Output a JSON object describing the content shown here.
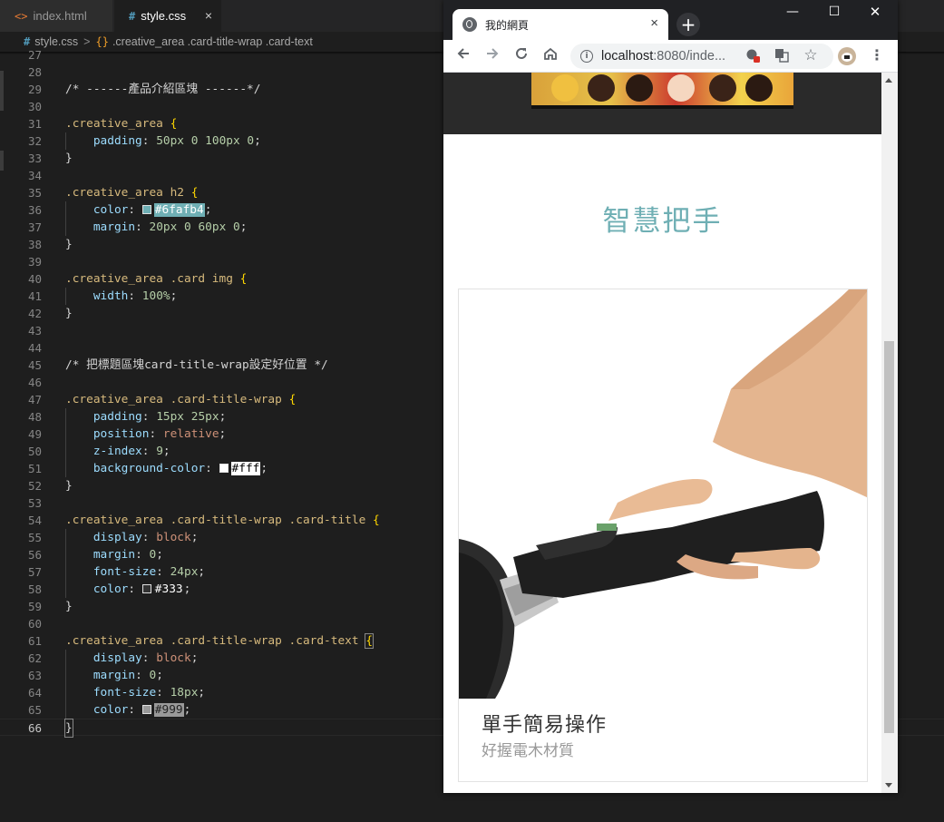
{
  "editor": {
    "tabs": [
      {
        "icon": "<>",
        "label": "index.html"
      },
      {
        "icon": "#",
        "label": "style.css",
        "close": "×"
      }
    ],
    "breadcrumb": {
      "file_icon": "#",
      "file": "style.css",
      "separator": ">",
      "symbol_icon": "{}",
      "symbol": ".creative_area .card-title-wrap .card-text"
    },
    "lines": [
      {
        "n": "27",
        "text": ""
      },
      {
        "n": "28",
        "text": ""
      },
      {
        "n": "29",
        "text": "/* ------產品介紹區塊 ------*/"
      },
      {
        "n": "30",
        "text": ""
      },
      {
        "n": "31",
        "text": ".creative_area {"
      },
      {
        "n": "32",
        "text": "    padding: 50px 0 100px 0;"
      },
      {
        "n": "33",
        "text": "}"
      },
      {
        "n": "34",
        "text": ""
      },
      {
        "n": "35",
        "text": ".creative_area h2 {"
      },
      {
        "n": "36",
        "text": "    color: #6fafb4;"
      },
      {
        "n": "37",
        "text": "    margin: 20px 0 60px 0;"
      },
      {
        "n": "38",
        "text": "}"
      },
      {
        "n": "39",
        "text": ""
      },
      {
        "n": "40",
        "text": ".creative_area .card img {"
      },
      {
        "n": "41",
        "text": "    width: 100%;"
      },
      {
        "n": "42",
        "text": "}"
      },
      {
        "n": "43",
        "text": ""
      },
      {
        "n": "44",
        "text": ""
      },
      {
        "n": "45",
        "text": "/* 把標題區塊card-title-wrap設定好位置 */"
      },
      {
        "n": "46",
        "text": ""
      },
      {
        "n": "47",
        "text": ".creative_area .card-title-wrap {"
      },
      {
        "n": "48",
        "text": "    padding: 15px 25px;"
      },
      {
        "n": "49",
        "text": "    position: relative;"
      },
      {
        "n": "50",
        "text": "    z-index: 9;"
      },
      {
        "n": "51",
        "text": "    background-color: #fff;"
      },
      {
        "n": "52",
        "text": "}"
      },
      {
        "n": "53",
        "text": ""
      },
      {
        "n": "54",
        "text": ".creative_area .card-title-wrap .card-title {"
      },
      {
        "n": "55",
        "text": "    display: block;"
      },
      {
        "n": "56",
        "text": "    margin: 0;"
      },
      {
        "n": "57",
        "text": "    font-size: 24px;"
      },
      {
        "n": "58",
        "text": "    color: #333;"
      },
      {
        "n": "59",
        "text": "}"
      },
      {
        "n": "60",
        "text": ""
      },
      {
        "n": "61",
        "text": ".creative_area .card-title-wrap .card-text {"
      },
      {
        "n": "62",
        "text": "    display: block;"
      },
      {
        "n": "63",
        "text": "    margin: 0;"
      },
      {
        "n": "64",
        "text": "    font-size: 18px;"
      },
      {
        "n": "65",
        "text": "    color: #999;"
      },
      {
        "n": "66",
        "text": "}"
      }
    ],
    "active_line": "66",
    "colors": {
      "background": "#1e1e1e",
      "comment": "#6a9955",
      "selector": "#d7ba7d",
      "property": "#9cdcfe",
      "number": "#b5cea8",
      "keyword": "#ce9178"
    }
  },
  "browser": {
    "tab_title": "我的網頁",
    "tab_close": "×",
    "new_tab": "+",
    "window_controls": {
      "minimize": "—",
      "maximize": "☐",
      "close": "✕"
    },
    "url_host": "localhost",
    "url_rest": ":8080/inde...",
    "info_icon": "i",
    "page": {
      "section_title": "智慧把手",
      "card_title": "單手簡易操作",
      "card_text": "好握電木材質"
    },
    "colors": {
      "section_title": "#6fafb4",
      "card_title": "#333333",
      "card_text": "#999999",
      "header_band": "#2a2a2a"
    }
  }
}
